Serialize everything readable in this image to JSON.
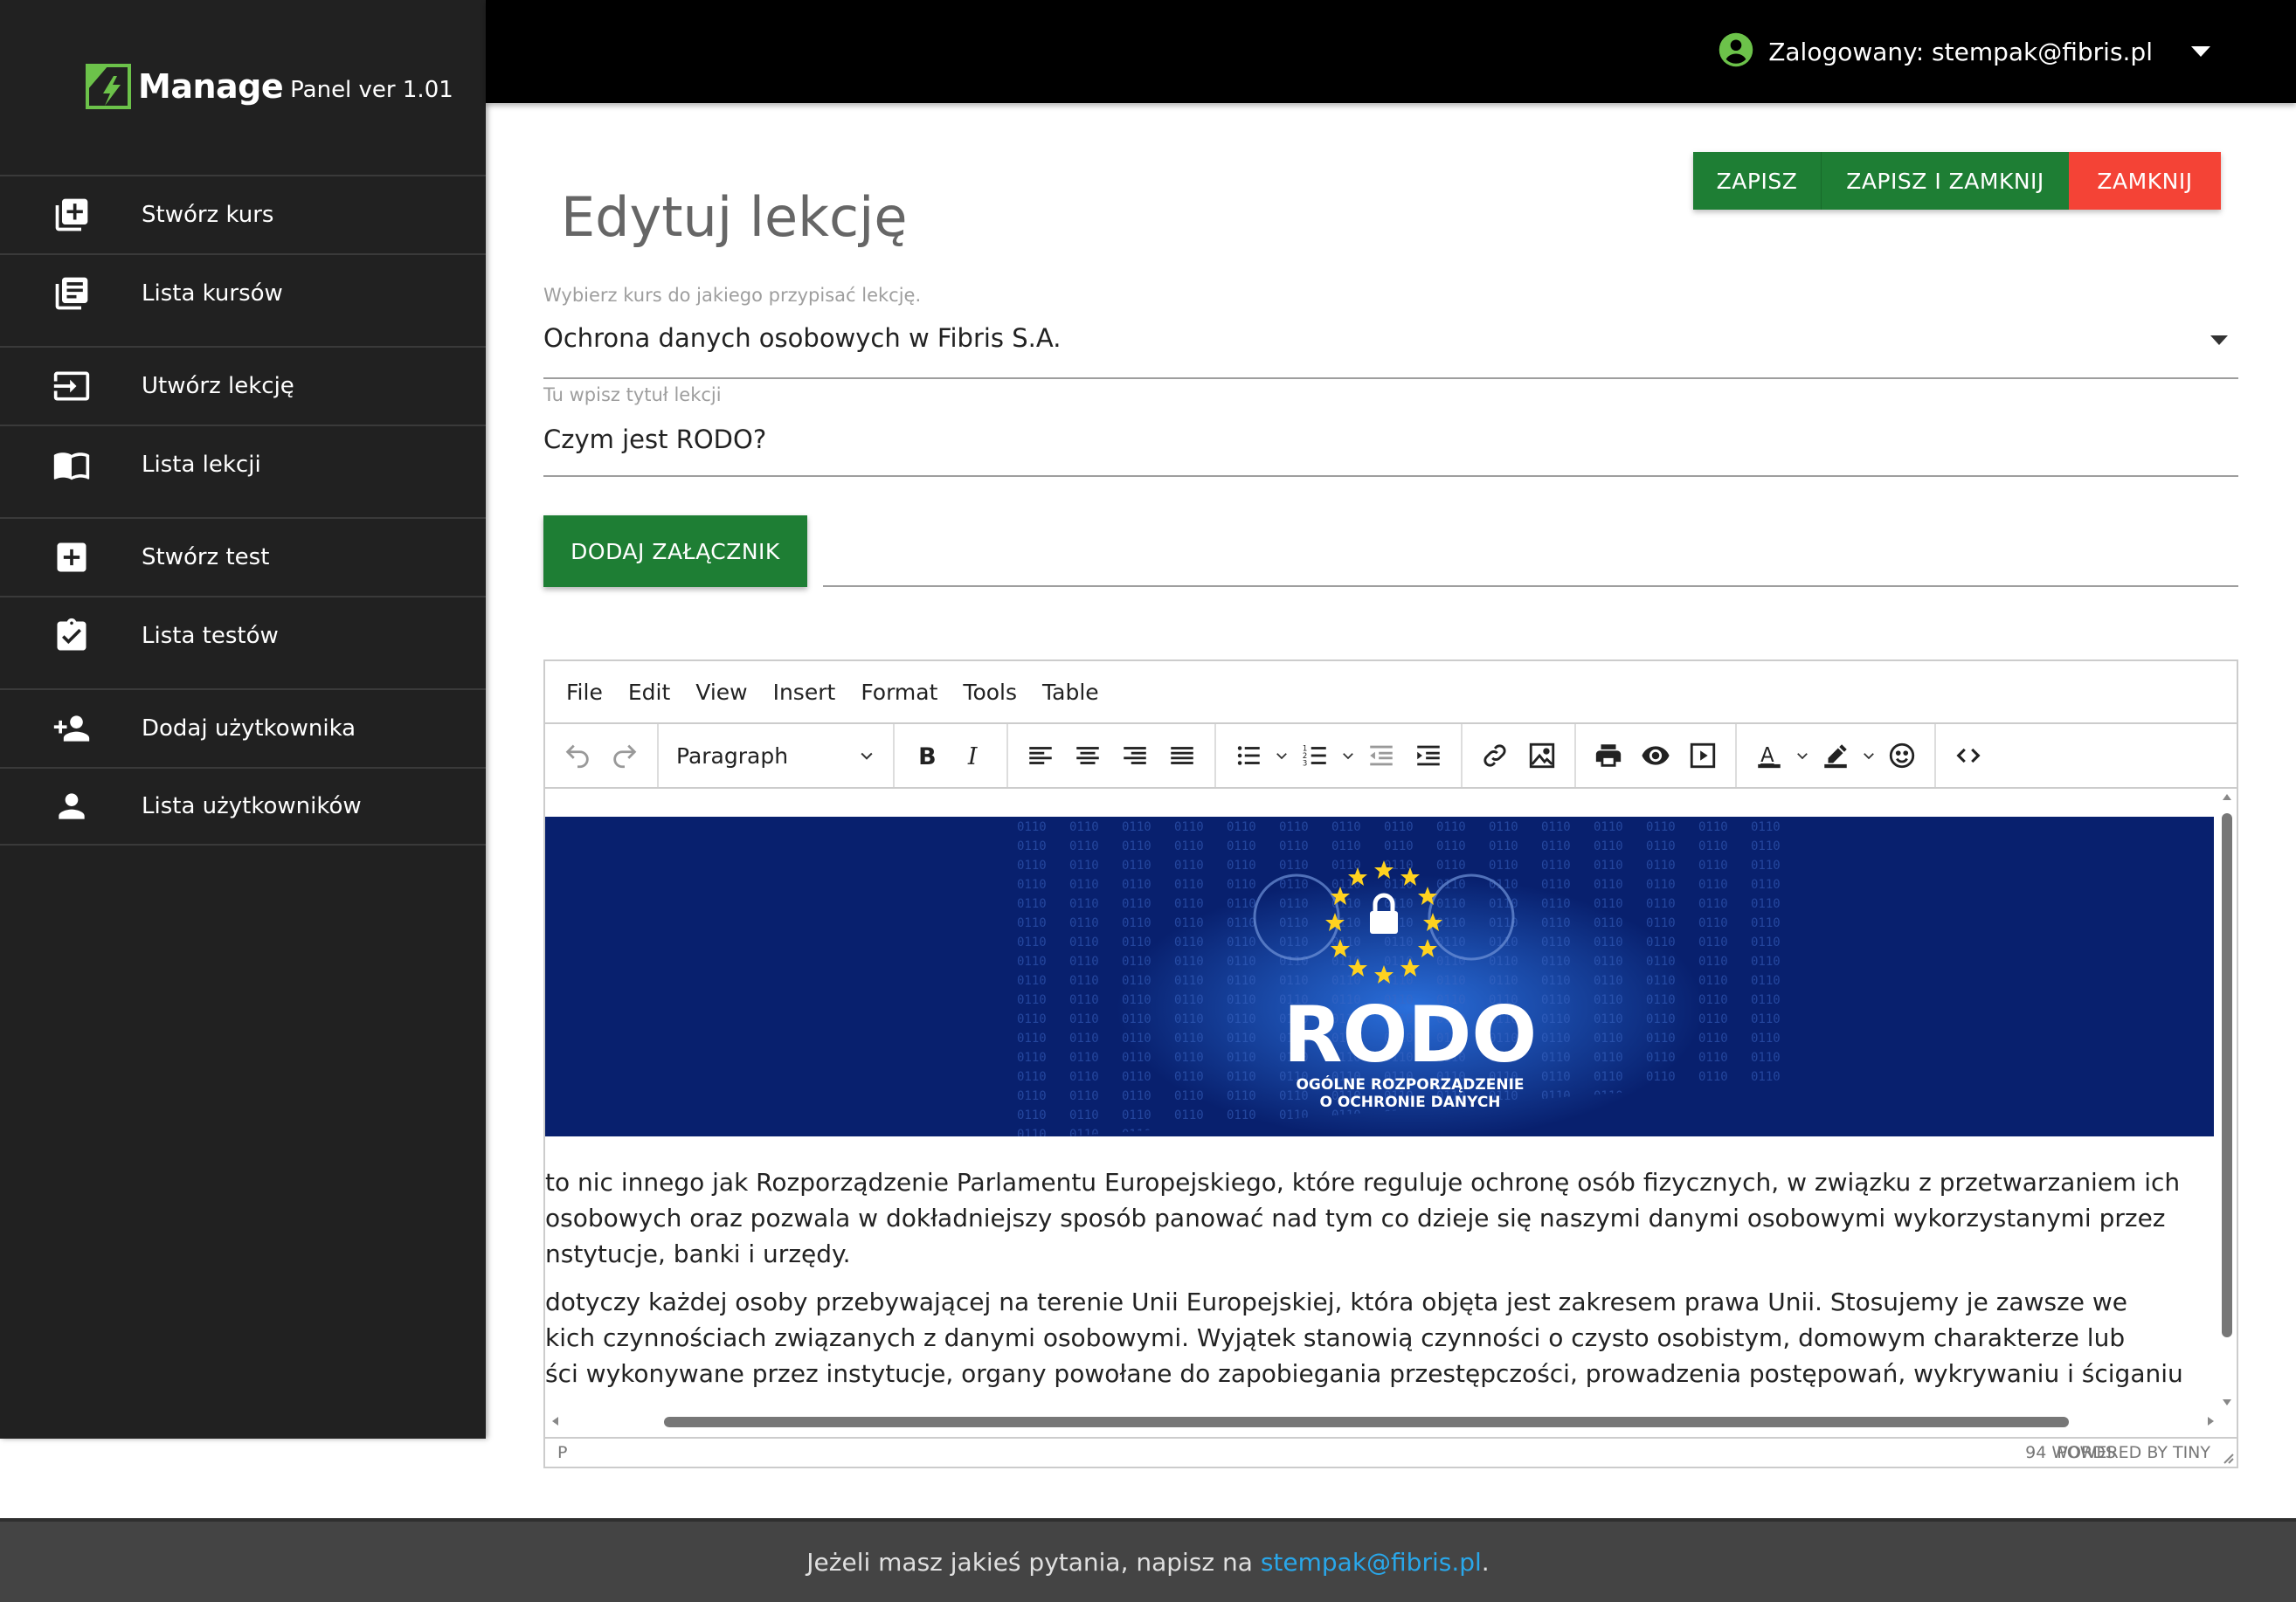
{
  "brand": {
    "name": "Manage",
    "subtitle": "Panel ver 1.01"
  },
  "sidebar": {
    "items": [
      {
        "label": "Stwórz kurs",
        "icon": "add-box-icon"
      },
      {
        "label": "Lista kursów",
        "icon": "library-books-icon"
      },
      {
        "label": "Utwórz lekcję",
        "icon": "login-box-icon"
      },
      {
        "label": "Lista lekcji",
        "icon": "open-book-icon"
      },
      {
        "label": "Stwórz test",
        "icon": "add-square-icon"
      },
      {
        "label": "Lista testów",
        "icon": "clipboard-check-icon"
      },
      {
        "label": "Dodaj użytkownika",
        "icon": "person-add-icon"
      },
      {
        "label": "Lista użytkowników",
        "icon": "person-icon"
      }
    ]
  },
  "header": {
    "user_text": "Zalogowany: stempak@fibris.pl",
    "user_icon": "account-circle-icon"
  },
  "page": {
    "title": "Edytuj lekcję"
  },
  "actions": {
    "save": "ZAPISZ",
    "save_close": "ZAPISZ I ZAMKNIJ",
    "close": "ZAMKNIJ"
  },
  "form": {
    "course_label": "Wybierz kurs do jakiego przypisać lekcję.",
    "course_value": "Ochrona danych osobowych w Fibris S.A.",
    "title_label": "Tu wpisz tytuł lekcji",
    "title_value": "Czym jest RODO?",
    "attach_button": "DODAJ ZAŁĄCZNIK"
  },
  "editor": {
    "menu": [
      "File",
      "Edit",
      "View",
      "Insert",
      "Format",
      "Tools",
      "Table"
    ],
    "block_format": "Paragraph",
    "banner": {
      "title": "RODO",
      "subtitle_line1": "OGÓLNE ROZPORZĄDZENIE",
      "subtitle_line2": "O OCHRONIE DANYCH"
    },
    "paragraph1": [
      "to nic innego jak Rozporządzenie Parlamentu Europejskiego, które reguluje ochronę osób fizycznych, w związku z przetwarzaniem ich",
      " osobowych oraz pozwala w dokładniejszy sposób panować nad tym co dzieje się naszymi danymi osobowymi wykorzystanymi przez",
      "nstytucje, banki i urzędy."
    ],
    "paragraph2": [
      "dotyczy każdej osoby przebywającej na terenie Unii Europejskiej, która objęta jest zakresem prawa Unii. Stosujemy je zawsze we",
      "kich czynnościach związanych z danymi osobowymi. Wyjątek stanowią czynności o czysto osobistym,  domowym charakterze lub",
      "ści wykonywane przez instytucje, organy powołane do zapobiegania przestępczości, prowadzenia postępowań, wykrywaniu i ściganiu"
    ],
    "status_path": "P",
    "word_count": "94 WORDS",
    "powered_by": "POWERED BY TINY"
  },
  "footer": {
    "text": "Jeżeli masz jakieś pytania, napisz na ",
    "email": "stempak@fibris.pl",
    "suffix": "."
  },
  "colors": {
    "green": "#1e7e34",
    "red": "#f44336",
    "sidebar": "#212121",
    "topbar": "#000000",
    "accent_logo": "#6cc24a",
    "link": "#29a7ea"
  }
}
